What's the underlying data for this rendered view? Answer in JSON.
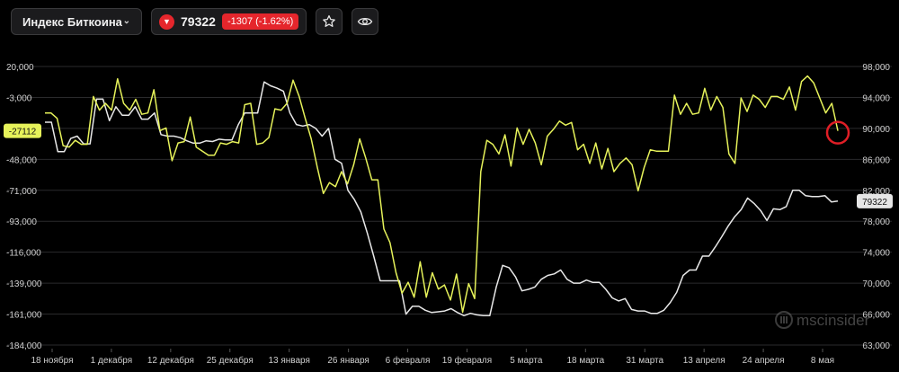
{
  "header": {
    "index_name": "Индекс Биткоина",
    "price": "79322",
    "change": "-1307 (-1.62%)"
  },
  "icons": {
    "dropdown": "chevron-down-icon",
    "down": "triangle-down-icon",
    "favorite": "star-icon",
    "watch": "eye-icon"
  },
  "colors": {
    "background": "#000000",
    "yellow_series": "#e6f25a",
    "white_series": "#e8e8e8",
    "down": "#e5262c",
    "marker": "#e01e26"
  },
  "watermark": "mscinsider",
  "chart_data": {
    "type": "line",
    "x_labels": [
      "18 ноября",
      "1 декабря",
      "12 декабря",
      "25 декабря",
      "13 января",
      "26 января",
      "6 февраля",
      "19 февраля",
      "5 марта",
      "18 марта",
      "31 марта",
      "13 апреля",
      "24 апреля",
      "8 мая"
    ],
    "left_axis": {
      "ticks": [
        "20,000",
        "-3,000",
        "-25,000",
        "-48,000",
        "-71,000",
        "-93,000",
        "-116,000",
        "-139,000",
        "-161,000",
        "-184,000"
      ],
      "range": [
        -184000,
        20000
      ]
    },
    "right_axis": {
      "ticks": [
        "98,000",
        "94,000",
        "90,000",
        "86,000",
        "82,000",
        "78,000",
        "74,000",
        "70,000",
        "66,000",
        "63,000"
      ],
      "range": [
        62000,
        98000
      ]
    },
    "grid": "horizontal",
    "series": [
      {
        "axis": "left",
        "last_label": "-27112",
        "values": [
          -14000,
          -14000,
          -18000,
          -38000,
          -39000,
          -34000,
          -37000,
          -37000,
          -2000,
          -12000,
          -7000,
          -12000,
          11000,
          -7000,
          -12000,
          -4000,
          -15000,
          -14000,
          3000,
          -27000,
          -25000,
          -49000,
          -36000,
          -35000,
          -17000,
          -39000,
          -42000,
          -45000,
          -45000,
          -36000,
          -37000,
          -35000,
          -36000,
          -8000,
          -7000,
          -37000,
          -36000,
          -32000,
          -11000,
          -12000,
          -7000,
          10000,
          -2000,
          -18000,
          -33000,
          -54000,
          -73000,
          -65000,
          -68000,
          -57000,
          -66000,
          -52000,
          -33000,
          -47000,
          -63000,
          -63000,
          -99000,
          -109000,
          -131000,
          -146000,
          -138000,
          -149000,
          -123000,
          -149000,
          -131000,
          -143000,
          -140000,
          -151000,
          -132000,
          -160000,
          -139000,
          -150000,
          -57000,
          -34000,
          -37000,
          -44000,
          -30000,
          -53000,
          -25000,
          -37000,
          -26000,
          -36000,
          -52000,
          -31000,
          -26000,
          -20000,
          -23000,
          -21000,
          -41000,
          -37000,
          -51000,
          -36000,
          -55000,
          -40000,
          -57000,
          -51000,
          -47000,
          -52000,
          -71000,
          -54000,
          -41000,
          -42000,
          -42000,
          -42000,
          -1000,
          -15000,
          -7000,
          -15000,
          -14000,
          4000,
          -12000,
          -2000,
          -10000,
          -44000,
          -51000,
          -3000,
          -13000,
          -1000,
          -4000,
          -10000,
          -2000,
          -2000,
          -4000,
          5000,
          -12000,
          9000,
          13000,
          8000,
          -3000,
          -14000,
          -7000,
          -27112
        ]
      },
      {
        "axis": "right",
        "last_label": "79322",
        "values": [
          90800,
          90800,
          87000,
          87000,
          88700,
          89000,
          88000,
          88000,
          93800,
          93800,
          91000,
          92800,
          91700,
          91700,
          92800,
          91200,
          91200,
          92000,
          89200,
          89000,
          89000,
          88800,
          88400,
          88100,
          88100,
          88400,
          88300,
          88600,
          88500,
          88500,
          90500,
          92000,
          92000,
          92000,
          96000,
          95500,
          95200,
          94800,
          92000,
          90500,
          90300,
          90500,
          90000,
          89000,
          90000,
          86000,
          85500,
          82000,
          80800,
          79200,
          76500,
          73500,
          70300,
          70300,
          70300,
          70300,
          66000,
          67000,
          67000,
          66500,
          66200,
          66300,
          66400,
          66700,
          66200,
          65800,
          66100,
          65900,
          65800,
          65800,
          69500,
          72300,
          72000,
          70800,
          69000,
          69200,
          69500,
          70500,
          71000,
          71200,
          71700,
          70500,
          70000,
          70000,
          70400,
          70100,
          70100,
          69200,
          68100,
          67700,
          68000,
          66600,
          66400,
          66400,
          66100,
          66100,
          66500,
          67500,
          68800,
          71000,
          71700,
          71700,
          73500,
          73500,
          74700,
          76000,
          77400,
          78600,
          79500,
          81000,
          80300,
          79400,
          78100,
          79600,
          79500,
          79900,
          82000,
          82000,
          81300,
          81200,
          81200,
          81300,
          80500,
          80600
        ]
      }
    ]
  }
}
